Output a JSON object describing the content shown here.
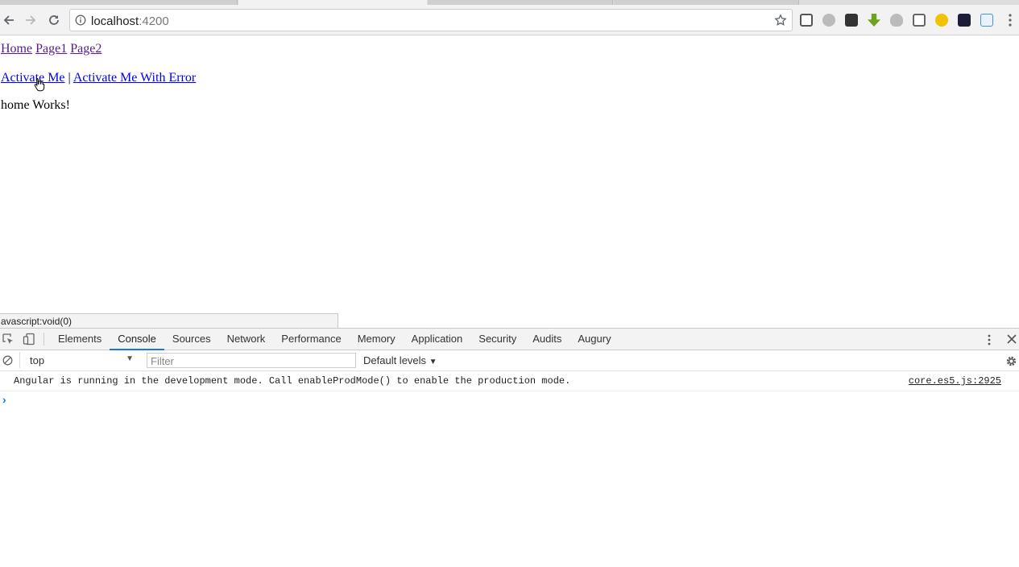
{
  "browser": {
    "url_host": "localhost",
    "url_port": ":4200"
  },
  "page": {
    "nav_links": [
      "Home",
      "Page1",
      "Page2"
    ],
    "activate_me": "Activate Me",
    "separator": "|",
    "activate_me_error": "Activate Me With Error",
    "home_message": "home Works!",
    "status_bar": "avascript:void(0)"
  },
  "devtools": {
    "tabs": [
      "Elements",
      "Console",
      "Sources",
      "Network",
      "Performance",
      "Memory",
      "Application",
      "Security",
      "Audits",
      "Augury"
    ],
    "active_tab": "Console",
    "context": "top",
    "filter_placeholder": "Filter",
    "levels": "Default levels",
    "message": "Angular is running in the development mode. Call enableProdMode() to enable the production mode.",
    "message_source": "core.es5.js:2925",
    "prompt": "›"
  },
  "icons": {
    "back": "back-arrow-icon",
    "forward": "forward-arrow-icon",
    "reload": "reload-icon",
    "info": "info-icon",
    "star": "star-icon",
    "inspect": "inspect-element-icon",
    "device": "device-toolbar-icon",
    "clear": "clear-console-icon",
    "settings": "gear-icon"
  },
  "colors": {
    "link": "#0000ee",
    "visited_link": "#551a8b",
    "active_tab": "#1a73e8"
  }
}
